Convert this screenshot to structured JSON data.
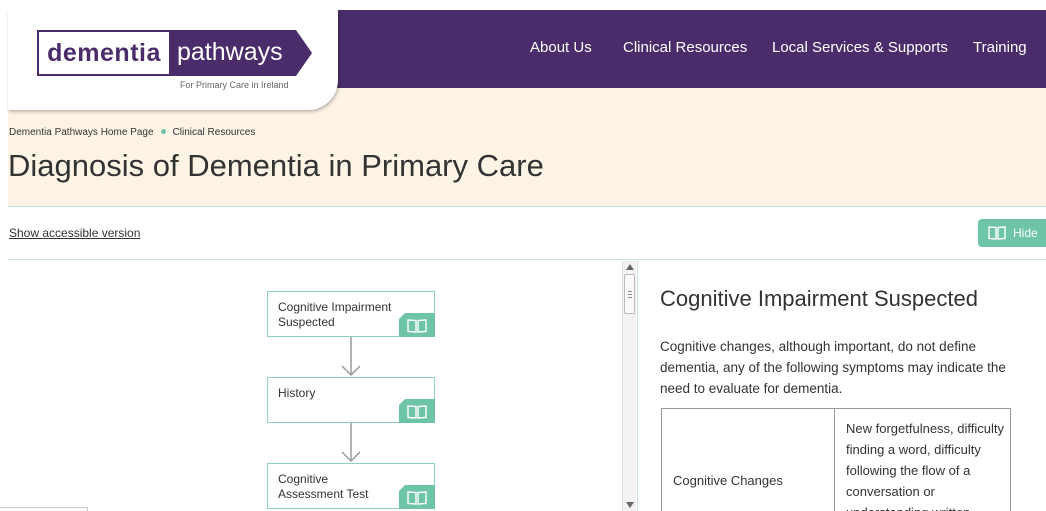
{
  "header": {
    "logo_part1": "dementia",
    "logo_part2": "pathways",
    "logo_tagline": "For Primary Care in Ireland",
    "nav": [
      "About Us",
      "Clinical Resources",
      "Local Services & Supports",
      "Training"
    ]
  },
  "breadcrumb": {
    "home": "Dementia Pathways Home Page",
    "current": "Clinical Resources"
  },
  "page_title": "Diagnosis of Dementia in Primary Care",
  "toolbar": {
    "accessible_link": "Show accessible version",
    "hide_label": "Hide"
  },
  "flowchart": {
    "steps": [
      {
        "label": "Cognitive Impairment Suspected"
      },
      {
        "label": "History"
      },
      {
        "label": "Cognitive Assessment Test"
      }
    ]
  },
  "info_panel": {
    "title": "Cognitive Impairment Suspected",
    "intro": "Cognitive changes, although important, do not define dementia, any of the following symptoms may indicate the need to evaluate for dementia.",
    "table_rows": [
      {
        "category": "Cognitive Changes",
        "description": "New forgetfulness, difficulty finding a word, difficulty following the flow of a conversation or understanding written"
      }
    ]
  },
  "colors": {
    "brand_purple": "#4a2c6a",
    "accent_green": "#6ec4a7",
    "peach": "#fdf4e6"
  },
  "icons": {
    "book": "open-book-icon"
  }
}
